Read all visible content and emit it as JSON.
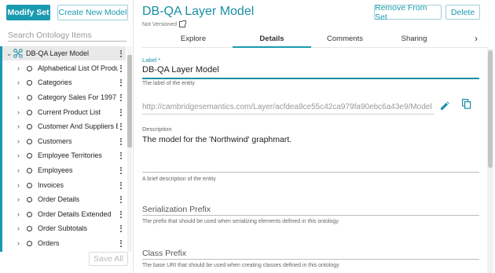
{
  "left_panel": {
    "modify_set_label": "Modify Set",
    "create_model_label": "Create New Model",
    "search_placeholder": "Search Ontology Items",
    "root_item": "DB-QA Layer Model",
    "items": [
      {
        "label": "Alphabetical List Of Products"
      },
      {
        "label": "Categories"
      },
      {
        "label": "Category Sales For 1997"
      },
      {
        "label": "Current Product List"
      },
      {
        "label": "Customer And Suppliers By City"
      },
      {
        "label": "Customers"
      },
      {
        "label": "Employee Territories"
      },
      {
        "label": "Employees"
      },
      {
        "label": "Invoices"
      },
      {
        "label": "Order Details"
      },
      {
        "label": "Order Details Extended"
      },
      {
        "label": "Order Subtotals"
      },
      {
        "label": "Orders"
      }
    ],
    "save_all_label": "Save All"
  },
  "header": {
    "title": "DB-QA Layer Model",
    "version_status": "Not Versioned",
    "remove_from_set_label": "Remove From Set",
    "delete_label": "Delete"
  },
  "tabs": {
    "explore": "Explore",
    "details": "Details",
    "comments": "Comments",
    "sharing": "Sharing"
  },
  "details": {
    "label_caption": "Label *",
    "label_value": "DB-QA Layer Model",
    "label_hint": "The label of the entity",
    "uri_value": "http://cambridgesemantics.com/Layer/acfdea8ce55c42ca979fa90ebc6a43e9/Model",
    "description_caption": "Description",
    "description_value": "The model for the 'Northwind' graphmart.",
    "description_hint": "A brief description of the entity",
    "serialization_prefix_label": "Serialization Prefix",
    "serialization_prefix_hint": "The prefix that should be used when serializing elements defined in this ontology",
    "class_prefix_label": "Class Prefix",
    "class_prefix_hint": "The base URI that should be used when creating classes defined in this ontology"
  },
  "colors": {
    "accent": "#1a9ab0",
    "title": "#1a8fa5"
  }
}
